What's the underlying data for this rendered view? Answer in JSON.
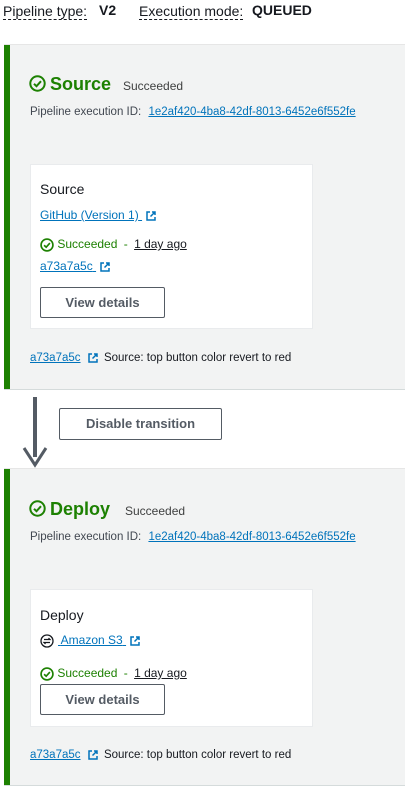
{
  "header": {
    "pipeline_type_label": "Pipeline type:",
    "pipeline_type_value": "V2",
    "execution_mode_label": "Execution mode:",
    "execution_mode_value": "QUEUED"
  },
  "stages": [
    {
      "title": "Source",
      "status": "Succeeded",
      "exec_label": "Pipeline execution ID:",
      "exec_id": "1e2af420-4ba8-42df-8013-6452e6f552fe",
      "action": {
        "name": "Source",
        "provider": "GitHub (Version 1)",
        "status": "Succeeded",
        "separator": "-",
        "time": "1 day ago",
        "commit": "a73a7a5c",
        "button": "View details"
      },
      "footer_commit": "a73a7a5c",
      "footer_message": "Source: top button color revert to red"
    },
    {
      "title": "Deploy",
      "status": "Succeeded",
      "exec_label": "Pipeline execution ID:",
      "exec_id": "1e2af420-4ba8-42df-8013-6452e6f552fe",
      "action": {
        "name": "Deploy",
        "provider": "Amazon S3",
        "status": "Succeeded",
        "separator": "-",
        "time": "1 day ago",
        "button": "View details"
      },
      "footer_commit": "a73a7a5c",
      "footer_message": "Source: top button color revert to red"
    }
  ],
  "transition": {
    "button": "Disable transition"
  },
  "colors": {
    "success": "#1d8102",
    "link": "#0073bb",
    "stage_bg": "#f2f3f3",
    "button_border": "#545b64"
  },
  "icons": [
    "check-circle-icon",
    "external-link-icon",
    "sync-icon",
    "arrow-down-icon"
  ]
}
